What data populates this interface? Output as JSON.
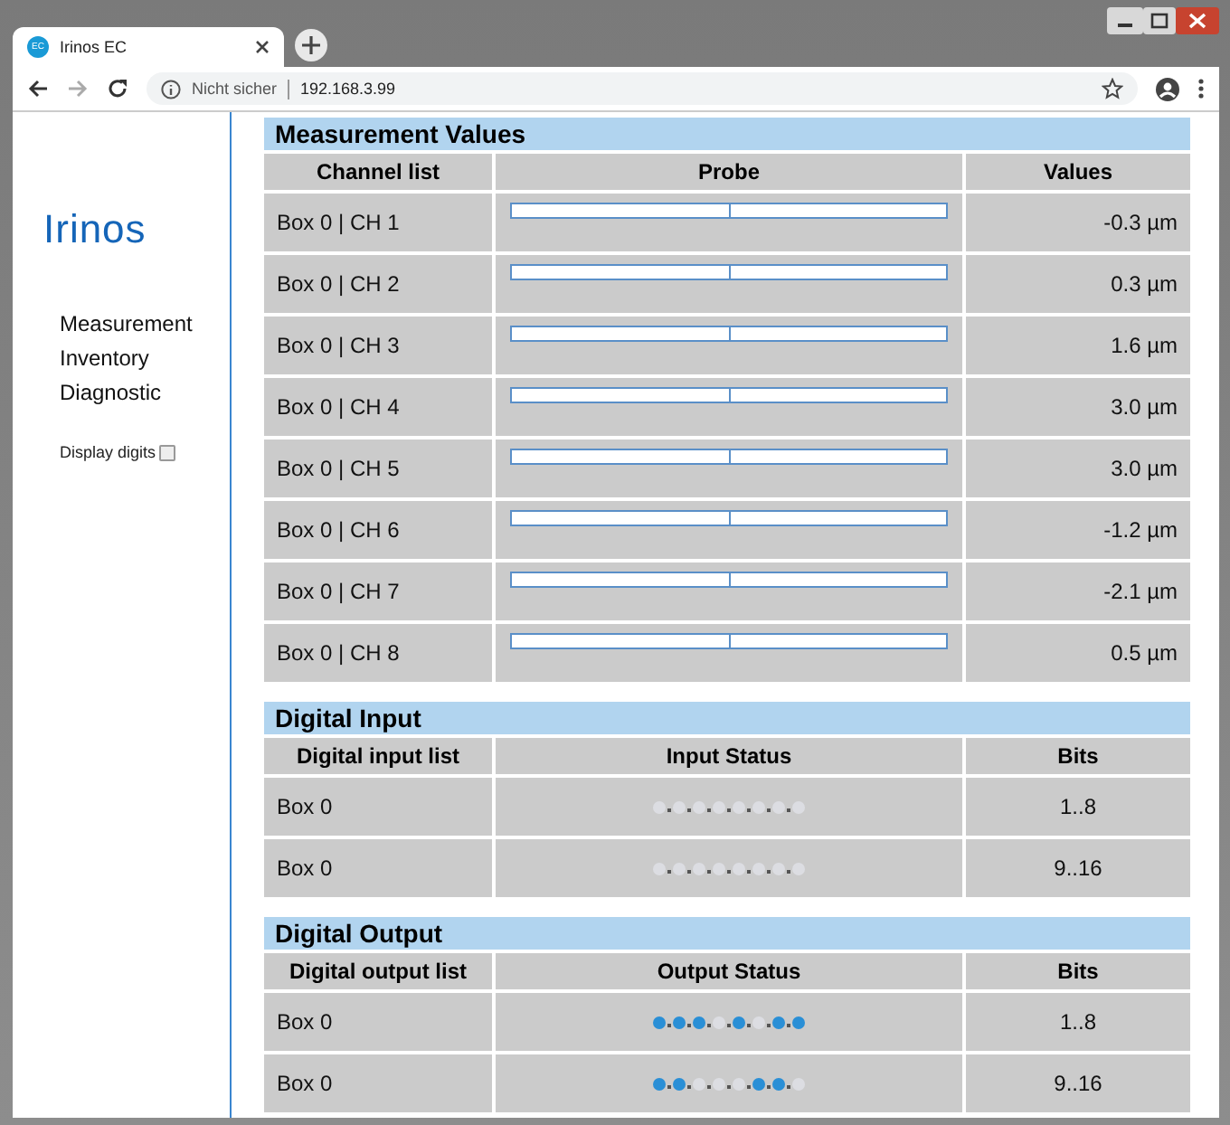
{
  "browser": {
    "tab_title": "Irinos EC",
    "favicon_text": "EC",
    "security_label": "Nicht sicher",
    "address": "192.168.3.99"
  },
  "sidebar": {
    "logo": "Irinos",
    "nav": [
      "Measurement",
      "Inventory",
      "Diagnostic"
    ],
    "display_digits": {
      "label": "Display digits",
      "checked": false
    }
  },
  "measurement": {
    "title": "Measurement Values",
    "columns": [
      "Channel list",
      "Probe",
      "Values"
    ],
    "rows": [
      {
        "channel": "Box 0 | CH 1",
        "value": "-0.3 µm"
      },
      {
        "channel": "Box 0 | CH 2",
        "value": "0.3 µm"
      },
      {
        "channel": "Box 0 | CH 3",
        "value": "1.6 µm"
      },
      {
        "channel": "Box 0 | CH 4",
        "value": "3.0 µm"
      },
      {
        "channel": "Box 0 | CH 5",
        "value": "3.0 µm"
      },
      {
        "channel": "Box 0 | CH 6",
        "value": "-1.2 µm"
      },
      {
        "channel": "Box 0 | CH 7",
        "value": "-2.1 µm"
      },
      {
        "channel": "Box 0 | CH 8",
        "value": "0.5 µm"
      }
    ]
  },
  "digital_input": {
    "title": "Digital Input",
    "columns": [
      "Digital input list",
      "Input Status",
      "Bits"
    ],
    "rows": [
      {
        "name": "Box 0",
        "bits_label": "1..8",
        "bits": [
          false,
          false,
          false,
          false,
          false,
          false,
          false,
          false
        ]
      },
      {
        "name": "Box 0",
        "bits_label": "9..16",
        "bits": [
          false,
          false,
          false,
          false,
          false,
          false,
          false,
          false
        ]
      }
    ]
  },
  "digital_output": {
    "title": "Digital Output",
    "columns": [
      "Digital output list",
      "Output Status",
      "Bits"
    ],
    "rows": [
      {
        "name": "Box 0",
        "bits_label": "1..8",
        "bits": [
          true,
          true,
          true,
          false,
          true,
          false,
          true,
          true
        ]
      },
      {
        "name": "Box 0",
        "bits_label": "9..16",
        "bits": [
          true,
          true,
          false,
          false,
          false,
          true,
          true,
          false
        ]
      }
    ]
  }
}
